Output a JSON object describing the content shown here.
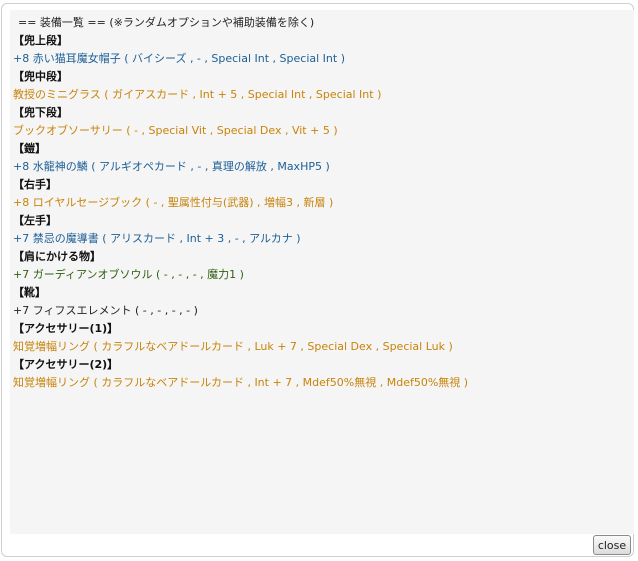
{
  "header": "== 装備一覧 == (※ランダムオプションや補助装備を除く)",
  "colors": {
    "blue": "#1c5f96",
    "orange": "#c8830a",
    "green": "#2e5f10",
    "black": "#222222"
  },
  "equipment": [
    {
      "slot": "【兜上段】",
      "item": "+8 赤い猫耳魔女帽子 ( バイシーズ , - , Special Int , Special Int )",
      "color": "blue"
    },
    {
      "slot": "【兜中段】",
      "item": "教授のミニグラス ( ガイアスカード , Int + 5 , Special Int , Special Int )",
      "color": "orange"
    },
    {
      "slot": "【兜下段】",
      "item": "ブックオブソーサリー ( - , Special Vit , Special Dex , Vit + 5 )",
      "color": "orange"
    },
    {
      "slot": "【鎧】",
      "item": "+8 水龍神の鱗 ( アルギオペカード , - , 真理の解放 , MaxHP5 )",
      "color": "blue"
    },
    {
      "slot": "【右手】",
      "item": "+8 ロイヤルセージブック ( - , 聖属性付与(武器) , 増幅3 , 新層 )",
      "color": "orange"
    },
    {
      "slot": "【左手】",
      "item": "+7 禁忌の魔導書 ( アリスカード , Int + 3 , - , アルカナ )",
      "color": "blue"
    },
    {
      "slot": "【肩にかける物】",
      "item": "+7 ガーディアンオブソウル ( - , - , - , 魔力1 )",
      "color": "green"
    },
    {
      "slot": "【靴】",
      "item": "+7 フィフスエレメント ( - , - , - , - )",
      "color": "black"
    },
    {
      "slot": "【アクセサリー(1)】",
      "item": "知覚増幅リング ( カラフルなベアドールカード , Luk + 7 , Special Dex , Special Luk )",
      "color": "orange"
    },
    {
      "slot": "【アクセサリー(2)】",
      "item": "知覚増幅リング ( カラフルなベアドールカード , Int + 7 , Mdef50%無視 , Mdef50%無視 )",
      "color": "orange"
    }
  ],
  "close_label": "close"
}
